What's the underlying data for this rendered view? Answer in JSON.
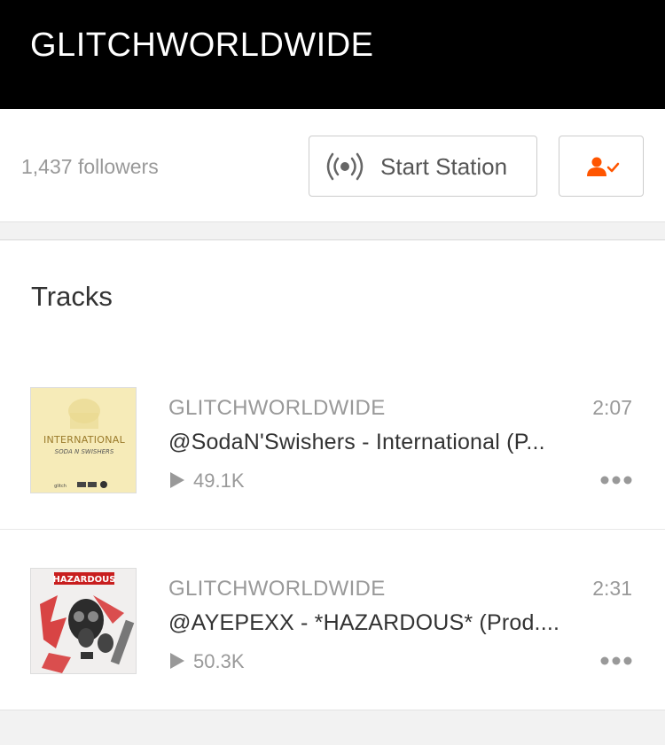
{
  "header": {
    "title": "GLITCHWORLDWIDE"
  },
  "profile": {
    "followers_text": "1,437 followers",
    "station_label": "Start Station",
    "station_icon": "broadcast-icon",
    "follow_icon": "user-following-icon",
    "accent_color": "#ff5500"
  },
  "tracks": {
    "title": "Tracks",
    "items": [
      {
        "user": "GLITCHWORLDWIDE",
        "duration": "2:07",
        "title": "@SodaN'Swishers - International (P...",
        "plays": "49.1K",
        "artwork_text": "INTERNATIONAL",
        "artwork_subtext": "SODA N SWISHERS",
        "artwork_footer": "glitch"
      },
      {
        "user": "GLITCHWORLDWIDE",
        "duration": "2:31",
        "title": "@AYEPEXX - *HAZARDOUS* (Prod....",
        "plays": "50.3K",
        "artwork_text": "HAZARDOUS"
      }
    ]
  }
}
